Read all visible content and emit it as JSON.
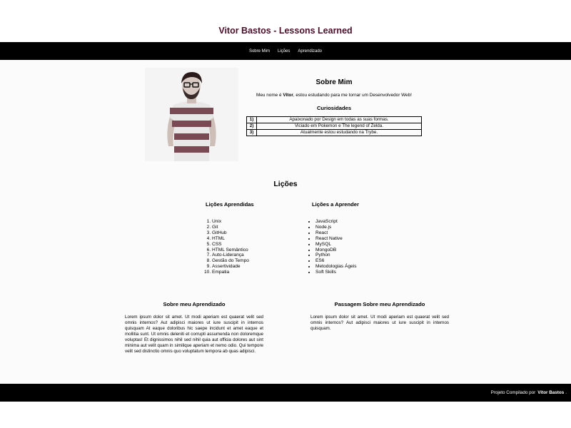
{
  "header": {
    "title": "Vitor Bastos - Lessons Learned"
  },
  "nav": {
    "items": [
      "Sobre Mim",
      "Lições",
      "Aprendizado"
    ]
  },
  "about": {
    "title": "Sobre Mim",
    "intro_prefix": "Meu nome é ",
    "intro_name": "Vitor",
    "intro_suffix": ", estou estudando para me tornar um Desenvolvedor Web!",
    "curiosities_title": "Curiosidades",
    "curiosities": [
      {
        "num": "1)",
        "text": "Apaixonado por Design em todas as suas formas."
      },
      {
        "num": "2)",
        "text": "Viciado em Pokemon e The legend of Zelda."
      },
      {
        "num": "3)",
        "text": "Atualmente estou estudando na Trybe."
      }
    ]
  },
  "lessons": {
    "title": "Lições",
    "learned_title": "Lições Aprendidas",
    "learned": [
      "Unix",
      "Git",
      "GitHub",
      "HTML",
      "CSS",
      "HTML Semântico",
      "Auto-Liderança",
      "Gestão do Tempo",
      "Assertividade",
      "Empatia"
    ],
    "to_learn_title": "Lições a Aprender",
    "to_learn": [
      "JavaScript",
      "Node.js",
      "React",
      "React Native",
      "MySQL",
      "MongoDB",
      "Python",
      "ES6",
      "Metodologias Ágeis",
      "Soft Skills"
    ]
  },
  "learning": {
    "about_title": "Sobre meu Aprendizado",
    "about_text": "Lorem ipsum dolor sit amet. Ut modi aperiam est quaerat velit sed omnis internos? Aut adipisci maiores ut iure suscipit in internos quisquam At eaque doloribus hic saepe incidunt et amet eaque et mollitia sunt. Ut omnis deleniti et corrupti assumenda non doloremque voluptas! Et dignissimos nihil sed nihil quia aut officia dolores aut sint minima aut velit quam in similique aperiam et nemo odio. Qui tempore velit sed distinctio omnis quo voluptatum tempora ab quas adipisci.",
    "passage_title": "Passagem Sobre meu Aprendizado",
    "passage_text": "Lorem ipsum dolor sit amet. Ut modi aperiam est quaerat velit sed omnis internos? Aut adipisci maiores ut iure suscipit in internos quisquam."
  },
  "footer": {
    "prefix": "Projeto Compilado por",
    "name": "Vitor Bastos",
    "suffix": "."
  },
  "colors": {
    "title": "#4a0f28",
    "bars": "#000000",
    "background": "#fbfbfb"
  }
}
